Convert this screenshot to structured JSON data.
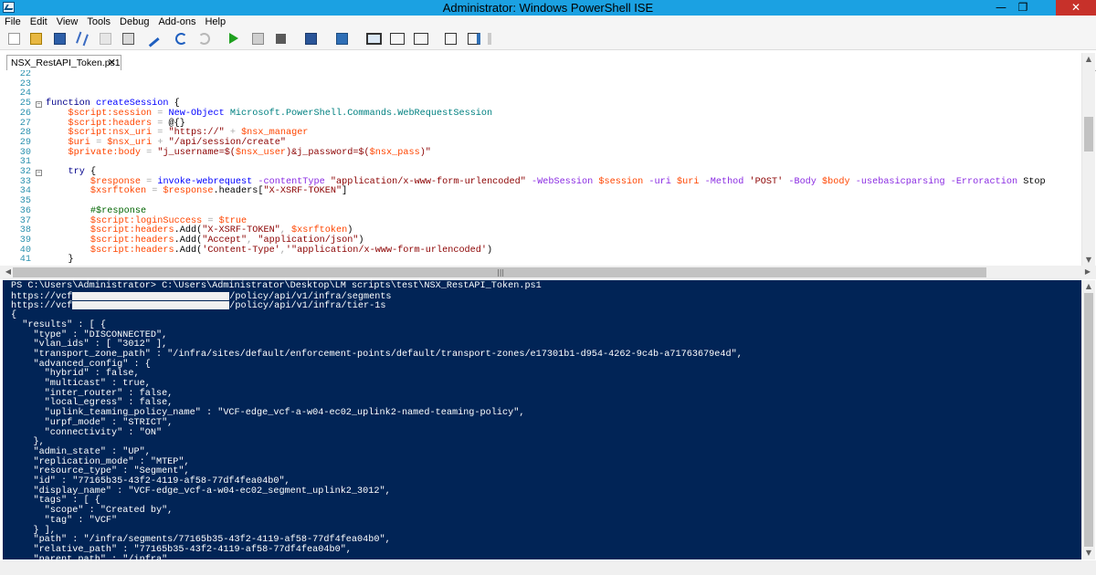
{
  "window": {
    "title": "Administrator: Windows PowerShell ISE",
    "minimize": "—",
    "restore": "❐",
    "close": "✕"
  },
  "menu": [
    "File",
    "Edit",
    "View",
    "Tools",
    "Debug",
    "Add-ons",
    "Help"
  ],
  "tab": {
    "label": "NSX_RestAPI_Token.ps1",
    "close": "✕"
  },
  "editor": {
    "line_numbers": [
      "22",
      "23",
      "24",
      "25",
      "26",
      "27",
      "28",
      "29",
      "30",
      "31",
      "32",
      "33",
      "34",
      "35",
      "36",
      "37",
      "38",
      "39",
      "40",
      "41"
    ]
  },
  "console": {
    "prompt": "PS C:\\Users\\Administrator> C:\\Users\\Administrator\\Desktop\\LM scripts\\test\\NSX_RestAPI_Token.ps1",
    "url1_prefix": "https://vcf",
    "url1_suffix": "/policy/api/v1/infra/segments",
    "url2_prefix": "https://vcf",
    "url2_suffix": "/policy/api/v1/infra/tier-1s",
    "json_lines": [
      "{",
      "  \"results\" : [ {",
      "    \"type\" : \"DISCONNECTED\",",
      "    \"vlan_ids\" : [ \"3012\" ],",
      "    \"transport_zone_path\" : \"/infra/sites/default/enforcement-points/default/transport-zones/e17301b1-d954-4262-9c4b-a71763679e4d\",",
      "    \"advanced_config\" : {",
      "      \"hybrid\" : false,",
      "      \"multicast\" : true,",
      "      \"inter_router\" : false,",
      "      \"local_egress\" : false,",
      "      \"uplink_teaming_policy_name\" : \"VCF-edge_vcf-a-w04-ec02_uplink2-named-teaming-policy\",",
      "      \"urpf_mode\" : \"STRICT\",",
      "      \"connectivity\" : \"ON\"",
      "    },",
      "    \"admin_state\" : \"UP\",",
      "    \"replication_mode\" : \"MTEP\",",
      "    \"resource_type\" : \"Segment\",",
      "    \"id\" : \"77165b35-43f2-4119-af58-77df4fea04b0\",",
      "    \"display_name\" : \"VCF-edge_vcf-a-w04-ec02_segment_uplink2_3012\",",
      "    \"tags\" : [ {",
      "      \"scope\" : \"Created by\",",
      "      \"tag\" : \"VCF\"",
      "    } ],",
      "    \"path\" : \"/infra/segments/77165b35-43f2-4119-af58-77df4fea04b0\",",
      "    \"relative_path\" : \"77165b35-43f2-4119-af58-77df4fea04b0\",",
      "    \"parent_path\" : \"/infra\","
    ]
  },
  "colors": {
    "titlebar": "#1ba1e2",
    "console_bg": "#012456",
    "close": "#c7312a"
  }
}
